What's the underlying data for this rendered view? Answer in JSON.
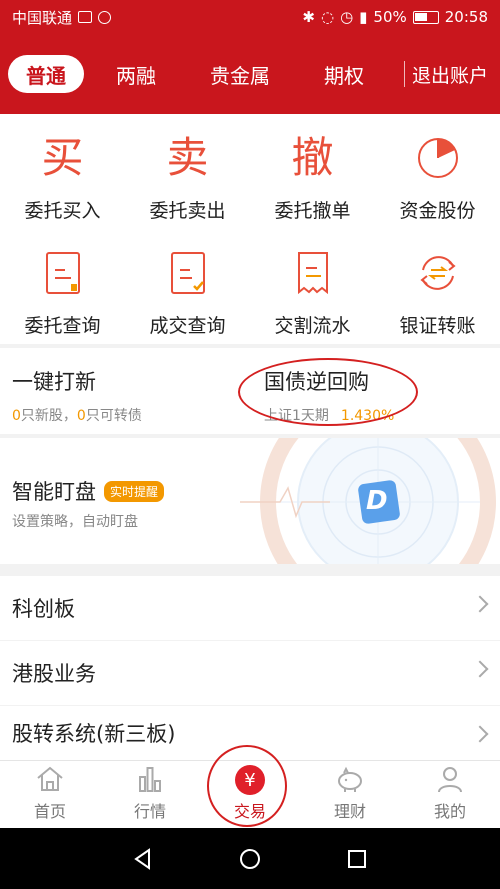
{
  "status_bar": {
    "carrier": "中国联通",
    "battery": "50%",
    "time": "20:58"
  },
  "header": {
    "tabs": [
      {
        "label": "普通",
        "active": true
      },
      {
        "label": "两融",
        "active": false
      },
      {
        "label": "贵金属",
        "active": false
      },
      {
        "label": "期权",
        "active": false
      }
    ],
    "logout_label": "退出账户"
  },
  "grid": {
    "row1": [
      {
        "char": "买",
        "label": "委托买入"
      },
      {
        "char": "卖",
        "label": "委托卖出"
      },
      {
        "char": "撤",
        "label": "委托撤单"
      },
      {
        "icon": "pie-chart-icon",
        "label": "资金股份"
      }
    ],
    "row2": [
      {
        "icon": "document-icon",
        "label": "委托查询"
      },
      {
        "icon": "document-check-icon",
        "label": "成交查询"
      },
      {
        "icon": "receipt-icon",
        "label": "交割流水"
      },
      {
        "icon": "transfer-icon",
        "label": "银证转账"
      }
    ]
  },
  "promo": {
    "ipo": {
      "title": "一键打新",
      "new_stock_count": "0",
      "new_stock_text": "只新股，",
      "bond_count": "0",
      "bond_text": "只可转债"
    },
    "repo": {
      "title": "国债逆回购",
      "market": "上证1天期",
      "rate": "1.430%"
    }
  },
  "smart": {
    "title": "智能盯盘",
    "badge": "实时提醒",
    "subtitle": "设置策略，自动盯盘",
    "logo_letter": "D"
  },
  "list": [
    {
      "label": "科创板"
    },
    {
      "label": "港股业务"
    },
    {
      "label": "股转系统(新三板)"
    }
  ],
  "bottom_nav": [
    {
      "label": "首页",
      "active": false
    },
    {
      "label": "行情",
      "active": false
    },
    {
      "label": "交易",
      "active": true,
      "symbol": "¥"
    },
    {
      "label": "理财",
      "active": false
    },
    {
      "label": "我的",
      "active": false
    }
  ],
  "colors": {
    "brand_red": "#c9161d",
    "accent_orange": "#f39800",
    "icon_red": "#e8503a"
  }
}
